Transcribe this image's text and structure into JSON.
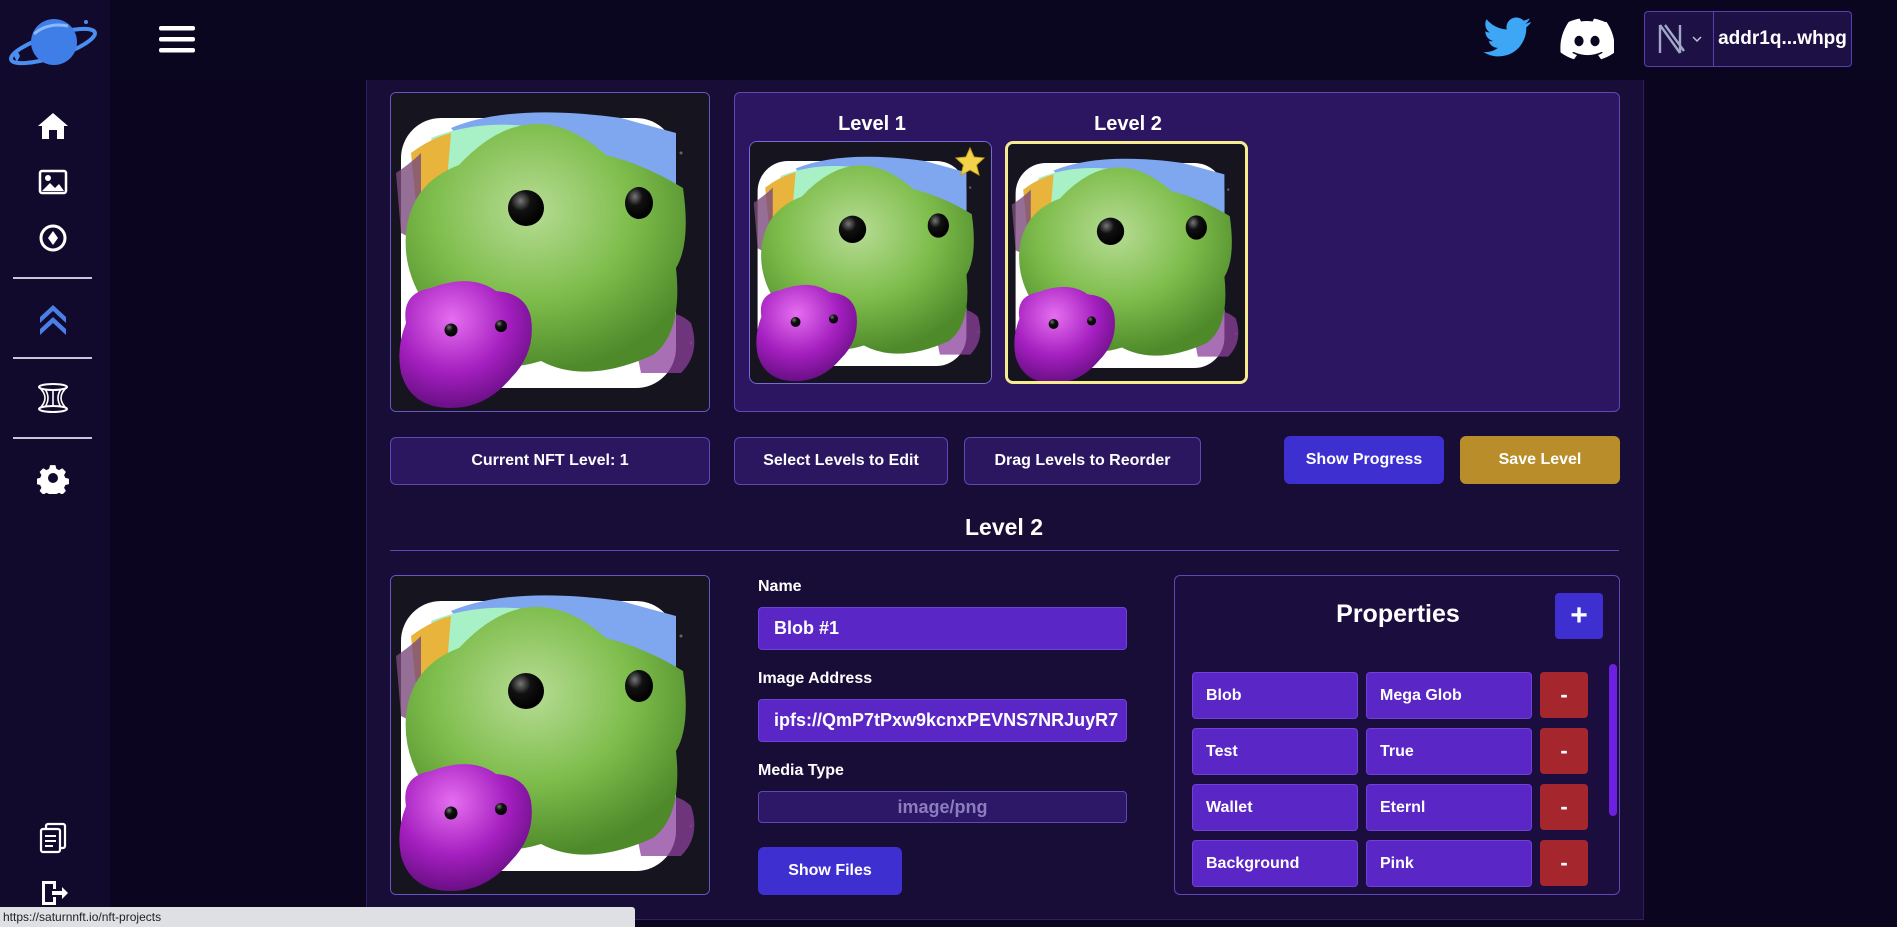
{
  "header": {
    "wallet_address": "addr1q...whpg"
  },
  "levels": [
    {
      "title": "Level 1",
      "is_current": true
    },
    {
      "title": "Level 2",
      "is_selected": true
    }
  ],
  "actions": {
    "current_level": "Current NFT Level: 1",
    "select_levels": "Select Levels to Edit",
    "drag_levels": "Drag Levels to Reorder",
    "show_progress": "Show Progress",
    "save_level": "Save Level"
  },
  "editor": {
    "section_title": "Level 2",
    "name_label": "Name",
    "name_value": "Blob #1",
    "image_label": "Image Address",
    "image_value": "ipfs://QmP7tPxw9kcnxPEVNS7NRJuyR7",
    "media_label": "Media Type",
    "media_value": "image/png",
    "show_files": "Show Files"
  },
  "properties": {
    "title": "Properties",
    "add": "+",
    "remove": "-",
    "rows": [
      {
        "key": "Blob",
        "value": "Mega Glob"
      },
      {
        "key": "Test",
        "value": "True"
      },
      {
        "key": "Wallet",
        "value": "Eternl"
      },
      {
        "key": "Background",
        "value": "Pink"
      }
    ]
  },
  "status_bar": {
    "url": "https://saturnnft.io/nft-projects"
  },
  "colors": {
    "accent_purple": "#5b26c6",
    "button_blue": "#3e2fd1",
    "button_gold": "#b98d2a",
    "delete_red": "#a6262e",
    "selected_border": "#f5eb8f"
  }
}
